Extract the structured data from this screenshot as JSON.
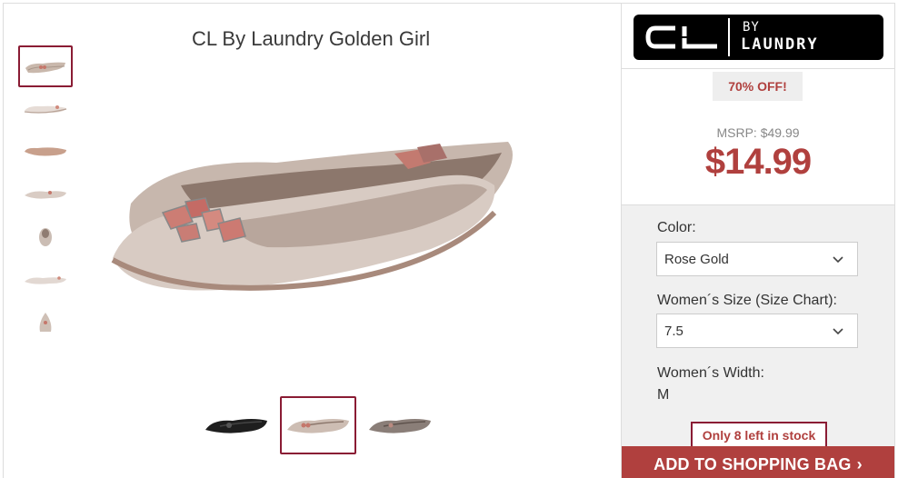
{
  "product": {
    "title": "CL By Laundry Golden Girl"
  },
  "brand": {
    "logo_main": "CL",
    "logo_by": "BY",
    "logo_laundry": "LAUNDRY"
  },
  "pricing": {
    "discount": "70% OFF!",
    "msrp": "MSRP: $49.99",
    "price": "$14.99"
  },
  "options": {
    "color_label": "Color:",
    "color_value": "Rose Gold",
    "size_label_prefix": "Women´s Size (",
    "size_chart_link": "Size Chart",
    "size_label_suffix": "):",
    "size_value": "7.5",
    "width_label": "Women´s Width:",
    "width_value": "M"
  },
  "stock": {
    "text": "Only 8 left in stock"
  },
  "cta": {
    "add_to_bag": "ADD TO SHOPPING BAG",
    "arrow": "›"
  },
  "colors": {
    "accent": "#b0403e",
    "selected_border": "#8a1c34",
    "panel_bg": "#f0f0f0"
  },
  "icons": {
    "thumbnail_views": [
      "pair-view",
      "side-view",
      "sole-view",
      "top-view",
      "heel-view",
      "profile-view",
      "toe-view"
    ],
    "colorways": [
      "black",
      "rose-gold",
      "pewter"
    ],
    "select_chevron": "chevron-down-icon"
  }
}
